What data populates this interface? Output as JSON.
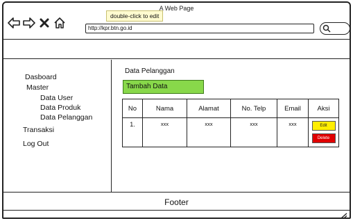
{
  "window": {
    "title": "A Web Page"
  },
  "tooltip": {
    "text": "double-click to edit"
  },
  "navbar": {
    "url": "http://kpr.btn.go.id",
    "back_icon": "back-arrow-icon",
    "forward_icon": "forward-arrow-icon",
    "stop_icon": "close-icon",
    "home_icon": "home-icon",
    "search_icon": "search-icon"
  },
  "sidebar": {
    "items": [
      {
        "label": "Dasboard"
      },
      {
        "label": "Master"
      },
      {
        "label": "Data User"
      },
      {
        "label": "Data Produk"
      },
      {
        "label": "Data Pelanggan"
      },
      {
        "label": "Transaksi"
      },
      {
        "label": "Log Out"
      }
    ]
  },
  "main": {
    "title": "Data Pelanggan",
    "add_button": "Tambah Data",
    "add_button_color": "#88d84a",
    "table": {
      "columns": [
        "No",
        "Nama",
        "Alamat",
        "No. Telp",
        "Email",
        "Aksi"
      ],
      "rows": [
        {
          "no": "1.",
          "nama": "xxx",
          "alamat": "xxx",
          "telp": "xxx",
          "email": "xxx",
          "edit_label": "Edit",
          "delete_label": "Delete"
        }
      ]
    },
    "edit_color": "#ffee00",
    "delete_color": "#e00000"
  },
  "footer": {
    "text": "Footer"
  }
}
